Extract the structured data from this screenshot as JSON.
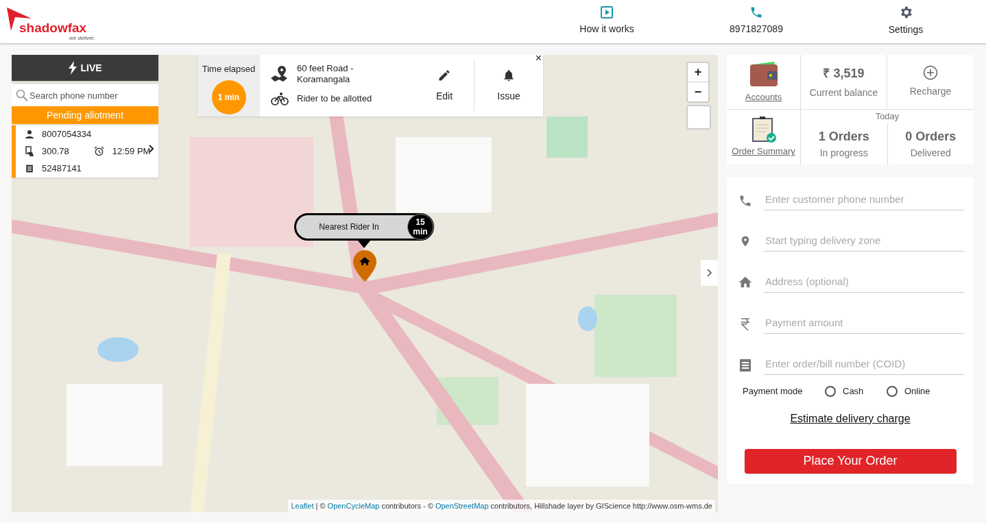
{
  "header": {
    "logo": {
      "name": "shadowfax",
      "tagline": "we deliver."
    },
    "nav": [
      {
        "kind": "play",
        "label": "How it works"
      },
      {
        "kind": "phone",
        "label": "8971827089"
      },
      {
        "kind": "gear",
        "label": "Settings"
      }
    ]
  },
  "live_panel": {
    "title": "LIVE",
    "search": {
      "placeholder": "Search phone number"
    },
    "status": "Pending allotment",
    "order": {
      "phone": "8007054334",
      "amount": "300.78",
      "time": "12:59 PM",
      "bill": "52487141"
    }
  },
  "order_card": {
    "time_label": "Time elapsed",
    "elapsed": "1 min",
    "address": "60 feet Road - Koramangala",
    "rider": "Rider to be allotted",
    "actions": [
      {
        "kind": "edit",
        "label": "Edit"
      },
      {
        "kind": "bell",
        "label": "Issue"
      }
    ],
    "close": "×"
  },
  "map": {
    "zoom_in": "+",
    "zoom_out": "−",
    "popup": {
      "label": "Nearest Rider In",
      "eta": "15",
      "unit": "min"
    },
    "attribution": [
      {
        "text": "Leaflet",
        "link": true
      },
      {
        "text": " | © ",
        "link": false
      },
      {
        "text": "OpenCycleMap",
        "link": true
      },
      {
        "text": " contributors - © ",
        "link": false
      },
      {
        "text": "OpenStreetMap",
        "link": true
      },
      {
        "text": " contributors, Hillshade layer by GIScience http://www.osm-wms.de",
        "link": false
      }
    ]
  },
  "summary": {
    "accounts": "Accounts",
    "balance": "₹ 3,519",
    "balance_label": "Current balance",
    "recharge": "Recharge",
    "today": "Today",
    "order_summary": "Order Summary",
    "stats": [
      {
        "value": "1 Orders",
        "label": "In progress"
      },
      {
        "value": "0 Orders",
        "label": "Delivered"
      }
    ]
  },
  "form": {
    "fields": [
      {
        "kind": "phone",
        "placeholder": "Enter customer phone number"
      },
      {
        "kind": "pin",
        "placeholder": "Start typing delivery zone"
      },
      {
        "kind": "home",
        "placeholder": "Address (optional)"
      },
      {
        "kind": "rupee",
        "placeholder": "Payment amount"
      },
      {
        "kind": "receipt",
        "placeholder": "Enter order/bill number (COID)"
      }
    ],
    "payment_mode": "Payment mode",
    "options": [
      {
        "label": "Cash",
        "selected": false
      },
      {
        "label": "Online",
        "selected": false
      }
    ],
    "estimate_link": "Estimate delivery charge",
    "submit": "Place Your Order"
  }
}
